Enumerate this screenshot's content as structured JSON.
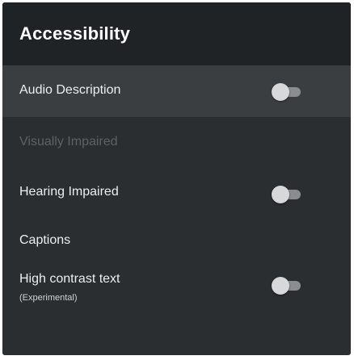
{
  "header": {
    "title": "Accessibility"
  },
  "rows": [
    {
      "label": "Audio Description",
      "toggle_on": false
    },
    {
      "label": "Visually Impaired"
    },
    {
      "label": "Hearing Impaired",
      "toggle_on": false
    },
    {
      "label": "Captions"
    },
    {
      "label": "High contrast text",
      "sublabel": "(Experimental)",
      "toggle_on": false
    }
  ],
  "colors": {
    "panel_bg": "#2a2e31",
    "header_bg": "#1f2326",
    "focused_row_bg": "#3a3e41",
    "disabled_text": "#5d6165"
  }
}
